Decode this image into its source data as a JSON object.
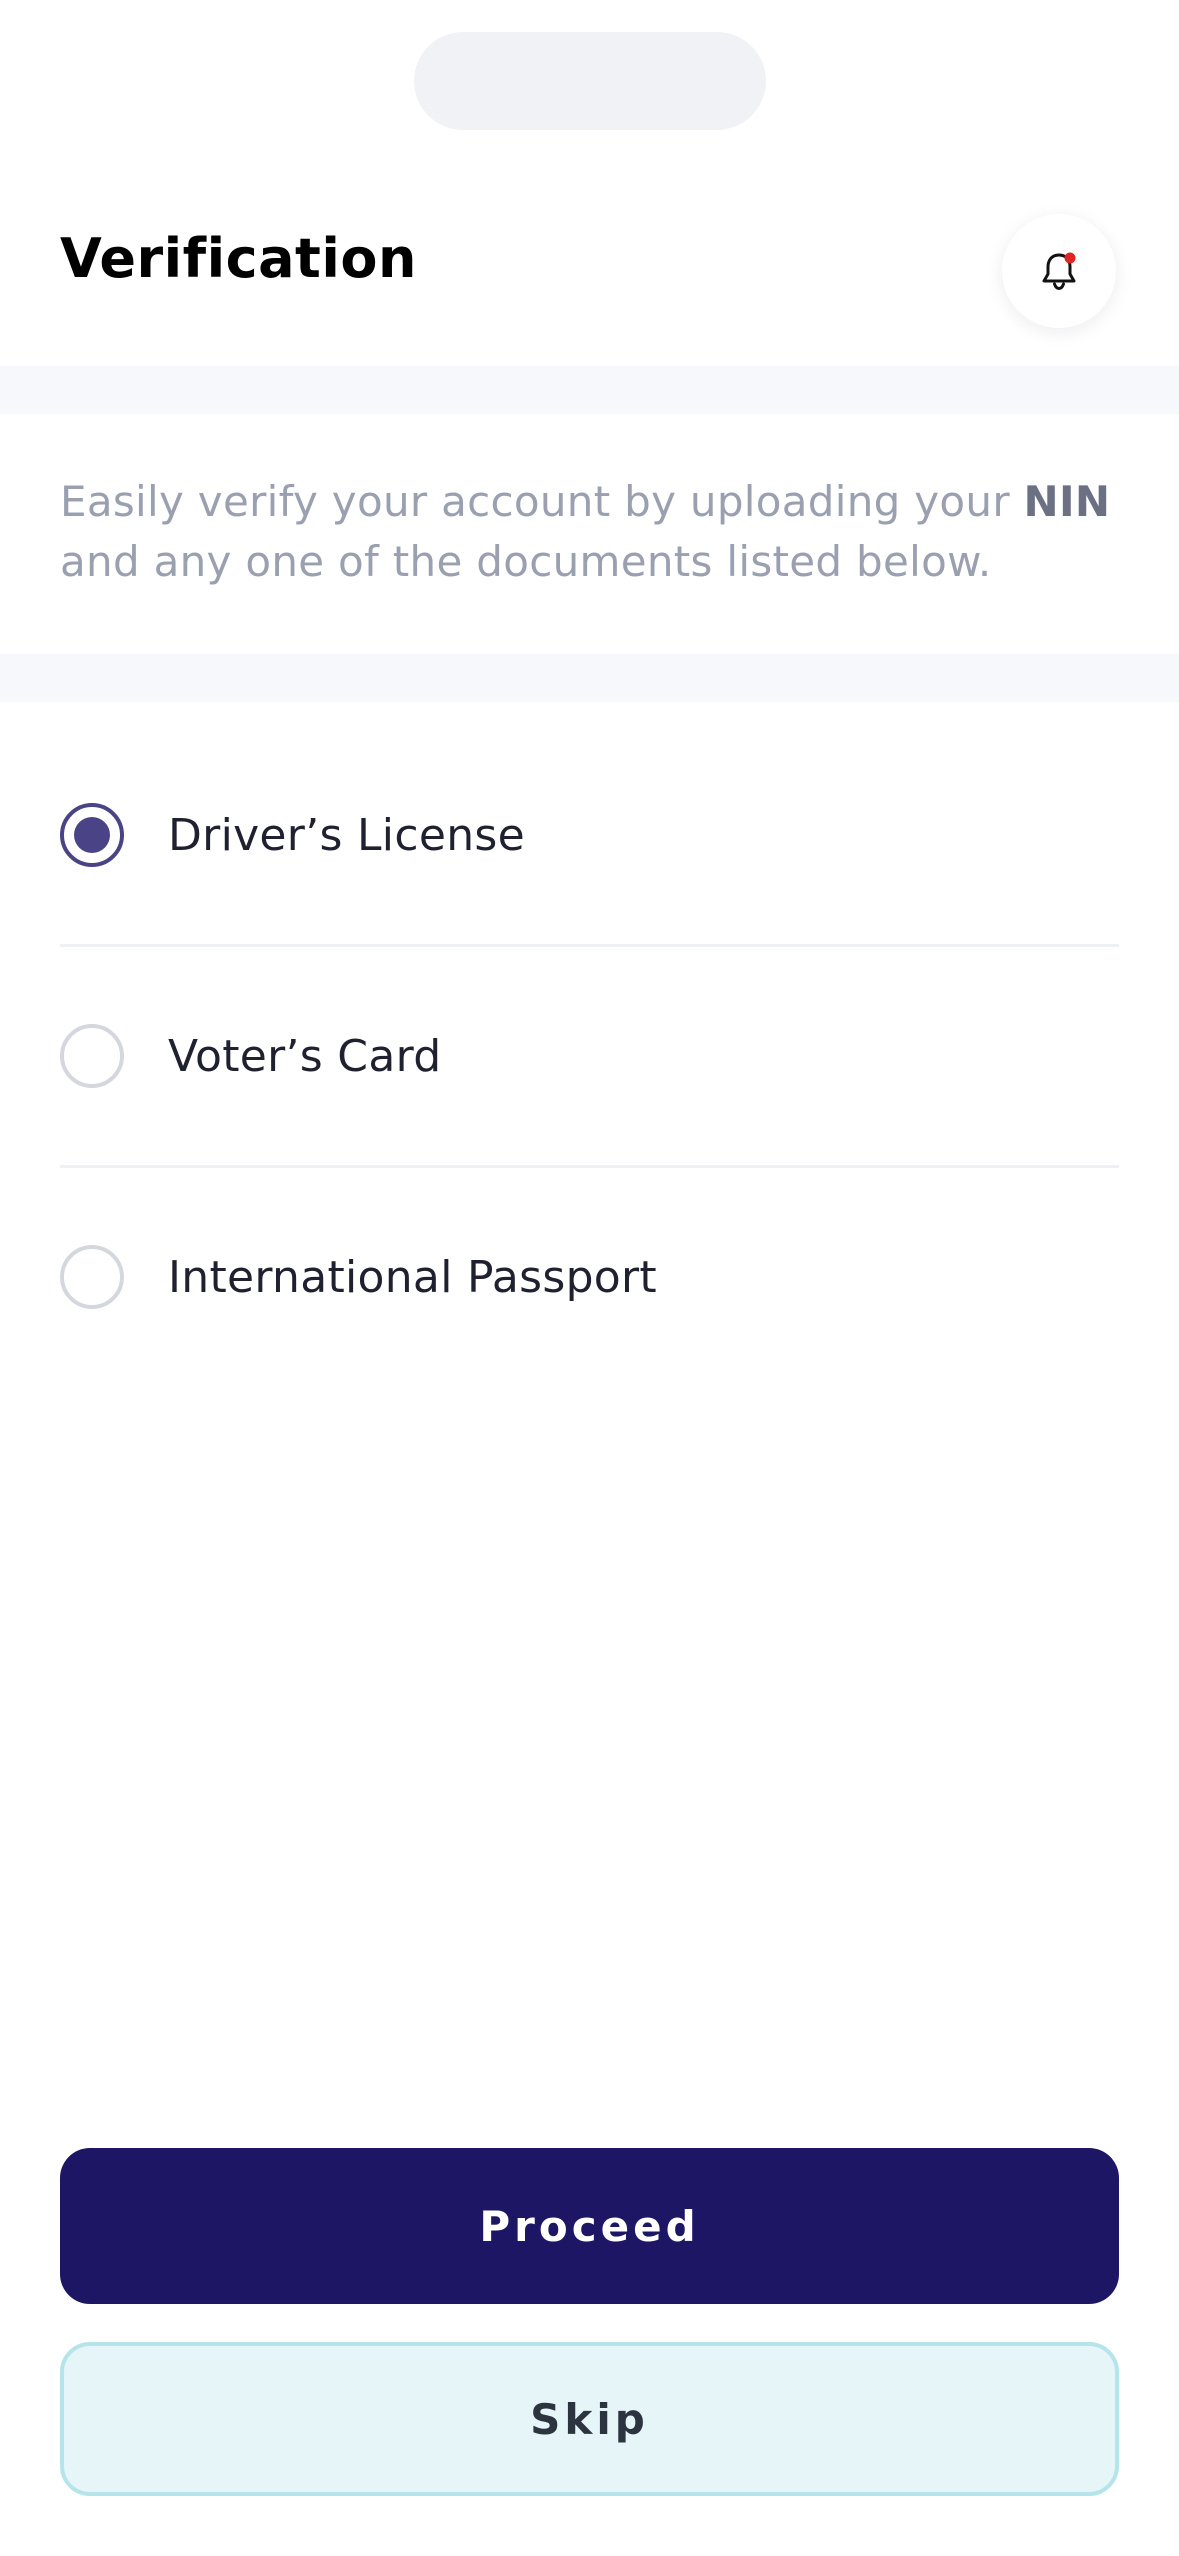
{
  "header": {
    "title": "Verification",
    "bell_icon": "bell-icon",
    "notification_dot_color": "#e02424"
  },
  "intro": {
    "text": "Easily verify your account by uploading your ",
    "highlight": "NIN",
    "text_after": " and any one of the documents listed below."
  },
  "options": [
    {
      "label": "Driver’s License",
      "selected": true
    },
    {
      "label": "Voter’s Card",
      "selected": false
    },
    {
      "label": "International Passport",
      "selected": false
    }
  ],
  "actions": {
    "proceed_label": "Proceed",
    "skip_label": "Skip"
  },
  "colors": {
    "primary": "#1d1665",
    "radio_selected": "#4a4487",
    "skip_background": "#e6f5f8",
    "skip_border": "#b5e4ea"
  }
}
